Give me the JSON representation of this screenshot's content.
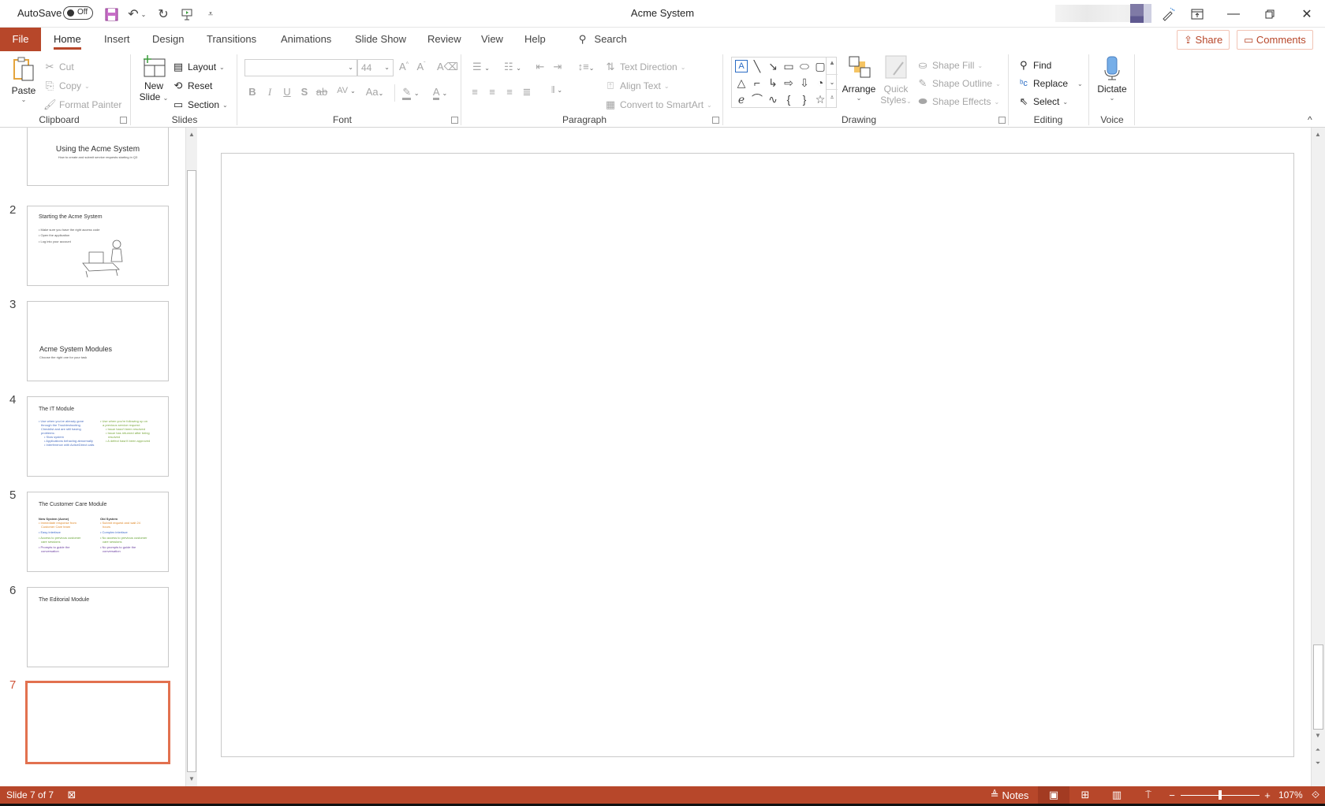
{
  "window": {
    "title": "Acme System",
    "autosave_label": "AutoSave",
    "autosave_state": "Off"
  },
  "tabs": {
    "file": "File",
    "items": [
      "Home",
      "Insert",
      "Design",
      "Transitions",
      "Animations",
      "Slide Show",
      "Review",
      "View",
      "Help"
    ],
    "active": "Home",
    "search": "Search",
    "share": "Share",
    "comments": "Comments"
  },
  "ribbon": {
    "clipboard": {
      "label": "Clipboard",
      "paste": "Paste",
      "cut": "Cut",
      "copy": "Copy",
      "format_painter": "Format Painter"
    },
    "slides": {
      "label": "Slides",
      "new_slide_line1": "New",
      "new_slide_line2": "Slide",
      "layout": "Layout",
      "reset": "Reset",
      "section": "Section"
    },
    "font": {
      "label": "Font",
      "font_name": "",
      "font_size": "44",
      "bold": "B",
      "italic": "I",
      "underline": "U",
      "shadow": "S",
      "strikethrough": "ab",
      "spacing": "AV",
      "change_case": "Aa"
    },
    "paragraph": {
      "label": "Paragraph",
      "text_direction": "Text Direction",
      "align_text": "Align Text",
      "convert_smartart": "Convert to SmartArt"
    },
    "drawing": {
      "label": "Drawing",
      "arrange": "Arrange",
      "quick_styles_line1": "Quick",
      "quick_styles_line2": "Styles",
      "shape_fill": "Shape Fill",
      "shape_outline": "Shape Outline",
      "shape_effects": "Shape Effects"
    },
    "editing": {
      "label": "Editing",
      "find": "Find",
      "replace": "Replace",
      "select": "Select"
    },
    "voice": {
      "label": "Voice",
      "dictate": "Dictate"
    }
  },
  "thumbnails": [
    {
      "number": "",
      "title": "Using the Acme System",
      "subtitle": "How to create and submit service requests starting in Q3",
      "bullets": []
    },
    {
      "number": "2",
      "title": "Starting the Acme System",
      "bullets": [
        "Make sure you have the right access code",
        "Open the application",
        "Log into your account"
      ]
    },
    {
      "number": "3",
      "title": "Acme System Modules",
      "subtitle": "Choose the right one for your task"
    },
    {
      "number": "4",
      "title": "The IT Module",
      "left_bullets": [
        "Use when you've already gone",
        "through the Troubleshooting",
        "Checklist and are still having",
        "problems:",
        "Slow system",
        "Applications behaving abnormally",
        "Interference with ActiveDirect calls"
      ],
      "right_bullets": [
        "Use when you're following up on",
        "a previous service request:",
        "Issue hasn't been resolved",
        "Issue has returned after being",
        "resolved",
        "A defect hasn't been approved"
      ]
    },
    {
      "number": "5",
      "title": "The Customer Care Module",
      "left_heading": "New System (Acme)",
      "left_bullets": [
        "Immediate response from",
        "Customer Care team",
        "Easy interface",
        "Access to previous customer",
        "care sessions",
        "Prompts to guide the",
        "conversation"
      ],
      "right_heading": "Old System",
      "right_bullets": [
        "Submit request and wait 24",
        "hours",
        "Complex interface",
        "No access to previous customer",
        "care sessions",
        "No prompts to guide the",
        "conversation"
      ]
    },
    {
      "number": "6",
      "title": "The Editorial Module"
    },
    {
      "number": "7",
      "title": ""
    }
  ],
  "status": {
    "slide_indicator": "Slide 7 of 7",
    "notes": "Notes",
    "zoom_level": "107%",
    "zoom_fraction": 0.5
  },
  "colors": {
    "accent": "#b7472a",
    "selected_thumb": "#e2714f",
    "t4_left": "#4a6fc1",
    "t4_right": "#7aa83c",
    "t5_orange": "#e08a2c",
    "t5_blue": "#3d6ac9",
    "t5_green": "#6aa53a",
    "t5_purple": "#6b3fa0"
  }
}
